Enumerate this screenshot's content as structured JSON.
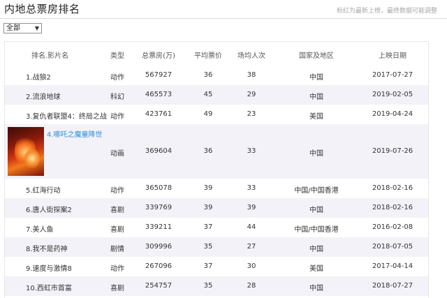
{
  "header": {
    "title": "内地总票房排名",
    "note": "标红为最新上榜，最终数据可能调整"
  },
  "filter": {
    "selected": "全部"
  },
  "table": {
    "columns": [
      "排名.影片名",
      "类型",
      "总票房(万)",
      "平均票价",
      "场均人次",
      "国家及地区",
      "上映日期"
    ],
    "rows": [
      {
        "name": "1.战狼2",
        "type": "动作",
        "gross": "567927",
        "avg_price": "36",
        "audience": "38",
        "region": "中国",
        "date": "2017-07-27"
      },
      {
        "name": "2.流浪地球",
        "type": "科幻",
        "gross": "465573",
        "avg_price": "45",
        "audience": "29",
        "region": "中国",
        "date": "2019-02-05"
      },
      {
        "name": "3.复仇者联盟4：终局之战",
        "type": "动作",
        "gross": "423761",
        "avg_price": "49",
        "audience": "23",
        "region": "美国",
        "date": "2019-04-24"
      },
      {
        "name": "4.哪吒之魔童降世",
        "type": "动画",
        "gross": "369604",
        "avg_price": "36",
        "audience": "33",
        "region": "中国",
        "date": "2019-07-26"
      },
      {
        "name": "5.红海行动",
        "type": "动作",
        "gross": "365078",
        "avg_price": "39",
        "audience": "33",
        "region": "中国/中国香港",
        "date": "2018-02-16"
      },
      {
        "name": "6.唐人街探案2",
        "type": "喜剧",
        "gross": "339769",
        "avg_price": "39",
        "audience": "39",
        "region": "中国",
        "date": "2018-02-16"
      },
      {
        "name": "7.美人鱼",
        "type": "喜剧",
        "gross": "339211",
        "avg_price": "37",
        "audience": "44",
        "region": "中国/中国香港",
        "date": "2016-02-08"
      },
      {
        "name": "8.我不是药神",
        "type": "剧情",
        "gross": "309996",
        "avg_price": "35",
        "audience": "27",
        "region": "中国",
        "date": "2018-07-05"
      },
      {
        "name": "9.速度与激情8",
        "type": "动作",
        "gross": "267096",
        "avg_price": "37",
        "audience": "30",
        "region": "美国",
        "date": "2017-04-14"
      },
      {
        "name": "10.西虹市首富",
        "type": "喜剧",
        "gross": "254757",
        "avg_price": "35",
        "audience": "28",
        "region": "中国",
        "date": "2018-07-27"
      }
    ]
  },
  "colors": {
    "link_blue": "#2d8fd8",
    "alt_row": "#f3f2f8",
    "divider": "#d9d9d9"
  },
  "icons": {
    "filter_dropdown": "chevron-down-icon",
    "poster": "movie-poster-image"
  }
}
